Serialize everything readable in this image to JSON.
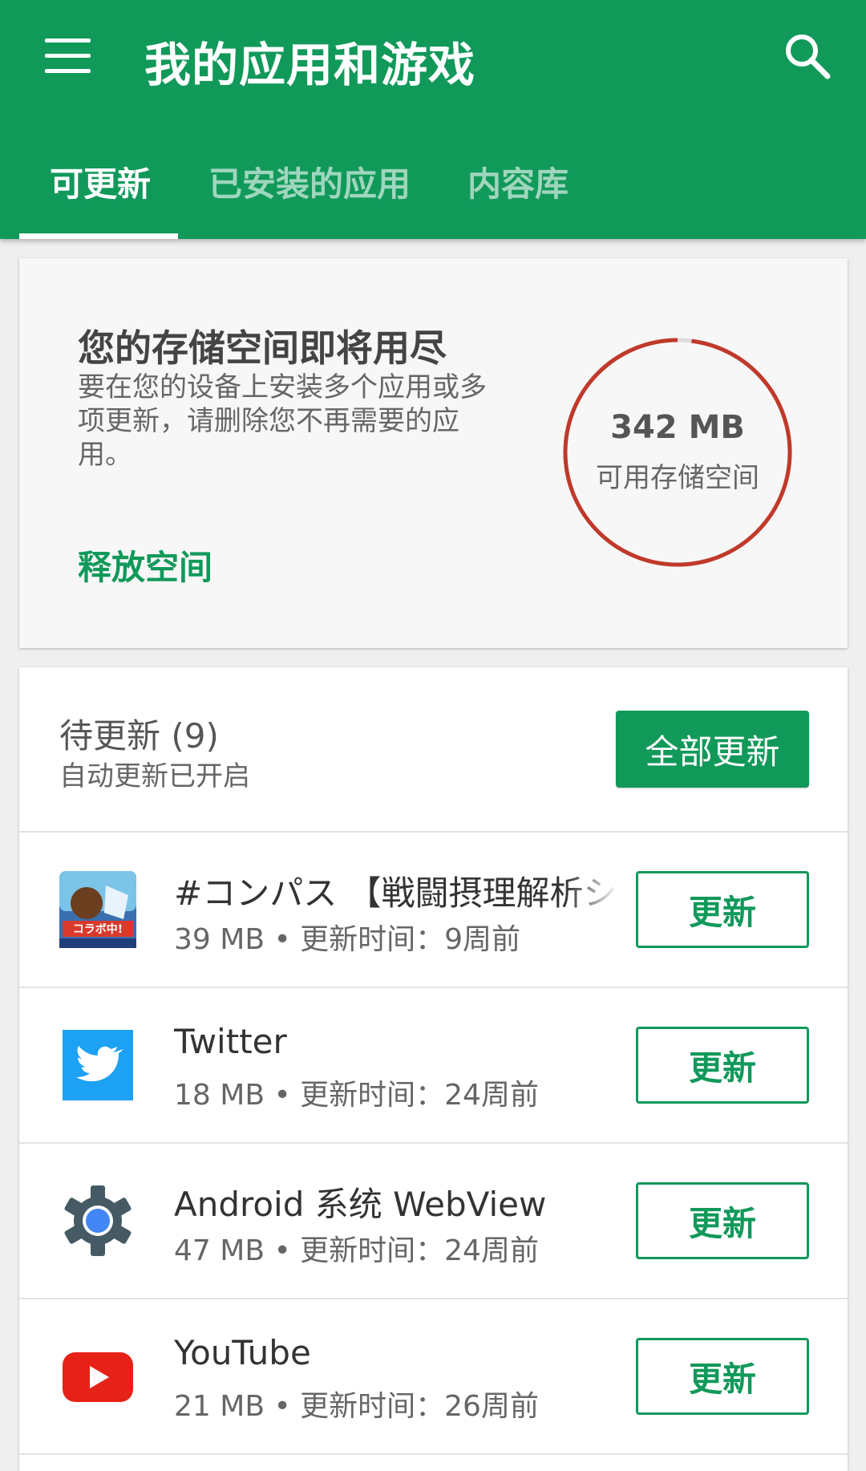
{
  "header": {
    "title": "我的应用和游戏",
    "tabs": [
      {
        "label": "可更新",
        "active": true
      },
      {
        "label": "已安装的应用",
        "active": false
      },
      {
        "label": "内容库",
        "active": false
      }
    ],
    "color": "#11995a"
  },
  "storage": {
    "title": "您的存储空间即将用尽",
    "description": "要在您的设备上安装多个应用或多项更新，请删除您不再需要的应用。",
    "action_label": "释放空间",
    "amount": "342 MB",
    "amount_label": "可用存储空间",
    "ring_color": "#c0392b",
    "used_fraction": 0.98
  },
  "updates": {
    "title": "待更新 (9)",
    "subtitle": "自动更新已开启",
    "update_all_label": "全部更新",
    "update_label": "更新",
    "apps": [
      {
        "name": "#コンパス 【戦闘摂理解析シ",
        "meta": "39 MB • 更新时间：9周前",
        "icon": "compass-game-icon"
      },
      {
        "name": "Twitter",
        "meta": "18 MB • 更新时间：24周前",
        "icon": "twitter-bird-icon"
      },
      {
        "name": "Android 系统 WebView",
        "meta": "47 MB • 更新时间：24周前",
        "icon": "webview-gear-icon"
      },
      {
        "name": "YouTube",
        "meta": "21 MB • 更新时间：26周前",
        "icon": "youtube-play-icon"
      }
    ]
  }
}
